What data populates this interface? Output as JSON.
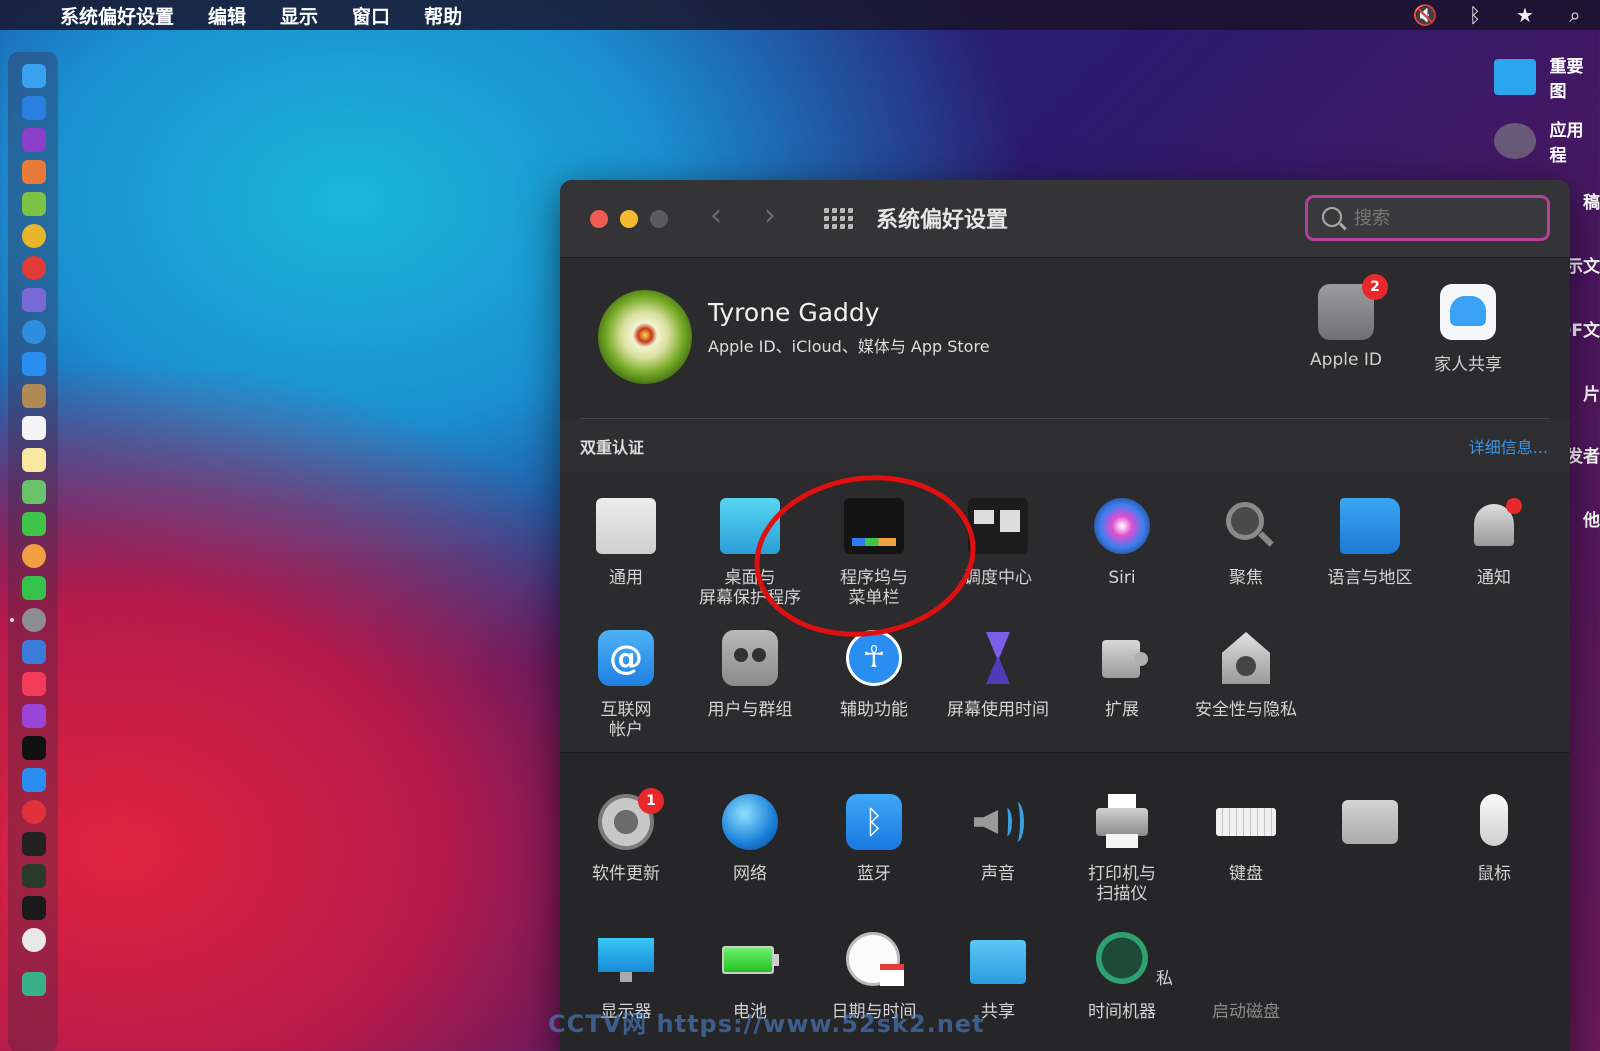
{
  "menubar": {
    "apple_icon": "apple-logo",
    "app_name": "系统偏好设置",
    "items": [
      "编辑",
      "显示",
      "窗口",
      "帮助"
    ],
    "status_icons": [
      "mute-icon",
      "bluetooth-icon",
      "star-icon",
      "search-icon"
    ]
  },
  "desktop": {
    "items": [
      {
        "label": "重要图",
        "icon": "folder-icon"
      },
      {
        "label": "应用程",
        "icon": "app-icon"
      }
    ],
    "fragments": [
      "稿",
      "示文",
      "DF文",
      "片",
      "发者",
      "他"
    ]
  },
  "window": {
    "title": "系统偏好设置",
    "search_placeholder": "搜索",
    "account": {
      "name": "Tyrone Gaddy",
      "subtitle": "Apple ID、iCloud、媒体与 App Store"
    },
    "top_icons": [
      {
        "label": "Apple ID",
        "badge": "2"
      },
      {
        "label": "家人共享"
      }
    ],
    "twofa": {
      "label": "双重认证",
      "link": "详细信息..."
    },
    "row1": [
      {
        "label": "通用"
      },
      {
        "label": "桌面与\n屏幕保护程序"
      },
      {
        "label": "程序坞与\n菜单栏"
      },
      {
        "label": "调度中心"
      },
      {
        "label": "Siri"
      },
      {
        "label": "聚焦"
      },
      {
        "label": "语言与地区"
      },
      {
        "label": "通知"
      }
    ],
    "row2": [
      {
        "label": "互联网\n帐户"
      },
      {
        "label": "用户与群组"
      },
      {
        "label": "辅助功能"
      },
      {
        "label": "屏幕使用时间"
      },
      {
        "label": "扩展"
      },
      {
        "label": "安全性与隐私"
      }
    ],
    "row3": [
      {
        "label": "软件更新",
        "badge": "1"
      },
      {
        "label": "网络"
      },
      {
        "label": "蓝牙"
      },
      {
        "label": "声音"
      },
      {
        "label": "打印机与\n扫描仪"
      },
      {
        "label": "键盘"
      },
      {
        "label": ""
      },
      {
        "label": "鼠标"
      }
    ],
    "row4": [
      {
        "label": "显示器"
      },
      {
        "label": "电池"
      },
      {
        "label": "日期与时间"
      },
      {
        "label": "共享"
      },
      {
        "label": "时间机器"
      },
      {
        "label": "启动磁盘"
      }
    ],
    "row4_fragment": "私"
  },
  "watermark": "CCTV网 https://www.52sk2.net",
  "colors": {
    "close": "#ee5c52",
    "minimize": "#f3bb2d",
    "zoom": "#5b5a5d",
    "search_border": "#b3409a",
    "link": "#3b93e8",
    "annotation": "#e01010"
  }
}
